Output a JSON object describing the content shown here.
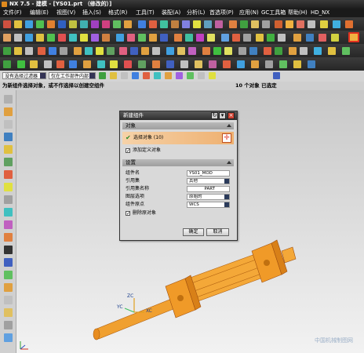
{
  "window": {
    "title": "NX 7.5 - 建模 - [YS01.prt （修改的）]"
  },
  "menu": [
    "文件(F)",
    "编辑(E)",
    "视图(V)",
    "插入(S)",
    "格式(R)",
    "工具(T)",
    "装配(A)",
    "分析(L)",
    "首选项(P)",
    "应用(N)",
    "GC工具箱",
    "帮助(H)",
    "HD_NX"
  ],
  "selection_bar": {
    "filter": "没有选择过滤器",
    "scope": "仅在工作部件内部"
  },
  "status": {
    "prompt": "为新组件选择对象，或不作选择以创建空组件",
    "count": "10 个对象 已选定"
  },
  "dialog": {
    "title": "新建组件",
    "section_objects": "对象",
    "select_objects": "选择对象 (10)",
    "add_defined_objects": "添加定义对象",
    "section_settings": "设置",
    "fields": [
      {
        "label": "组件名",
        "value": "YS01_MOD"
      },
      {
        "label": "引用集",
        "value": "其他"
      },
      {
        "label": "引用集名称",
        "value": "PART"
      },
      {
        "label": "图层选项",
        "value": "原始的"
      },
      {
        "label": "组件原点",
        "value": "WCS"
      }
    ],
    "delete_original": "删除原对象",
    "ok": "确定",
    "cancel": "取消"
  },
  "axes": {
    "zc": "ZC",
    "yc": "YC",
    "xc": "XC"
  },
  "watermark": "中国机械制图网",
  "colors": {
    "accent": "#e8942a",
    "model": "#f0a030",
    "highlight": "#e03020"
  }
}
